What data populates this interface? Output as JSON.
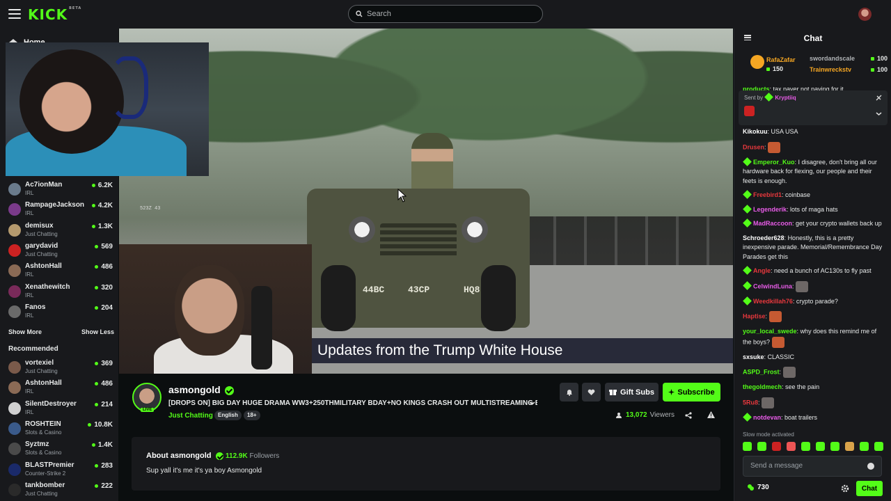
{
  "header": {
    "logo": "KICK",
    "logo_sup": "BETA",
    "search_placeholder": "Search"
  },
  "sidebar": {
    "home_label": "Home",
    "following": [
      {
        "name": "Ac7ionMan",
        "category": "IRL",
        "viewers": "6.2K",
        "color": "#6a7b8c"
      },
      {
        "name": "RampageJackson",
        "category": "IRL",
        "viewers": "4.2K",
        "color": "#7a3a8a"
      },
      {
        "name": "demisux",
        "category": "Just Chatting",
        "viewers": "1.3K",
        "color": "#b59a6e"
      },
      {
        "name": "garydavid",
        "category": "Just Chatting",
        "viewers": "569",
        "color": "#c22"
      },
      {
        "name": "AshtonHall",
        "category": "IRL",
        "viewers": "486",
        "color": "#8a6a55"
      },
      {
        "name": "Xenathewitch",
        "category": "IRL",
        "viewers": "320",
        "color": "#7a2a5a"
      },
      {
        "name": "Fanos",
        "category": "IRL",
        "viewers": "204",
        "color": "#6a6a6a"
      }
    ],
    "show_more": "Show More",
    "show_less": "Show Less",
    "recommended_heading": "Recommended",
    "recommended": [
      {
        "name": "vortexiel",
        "category": "Just Chatting",
        "viewers": "369",
        "color": "#7a5a4a"
      },
      {
        "name": "AshtonHall",
        "category": "IRL",
        "viewers": "486",
        "color": "#8a6a55"
      },
      {
        "name": "SilentDestroyer",
        "category": "IRL",
        "viewers": "214",
        "color": "#d0d0d0"
      },
      {
        "name": "ROSHTEIN",
        "category": "Slots & Casino",
        "viewers": "10.8K",
        "color": "#3a5a8a"
      },
      {
        "name": "Syztmz",
        "category": "Slots & Casino",
        "viewers": "1.4K",
        "color": "#4a4a4a"
      },
      {
        "name": "BLASTPremier",
        "category": "Counter-Strike 2",
        "viewers": "283",
        "color": "#1a2a6a"
      },
      {
        "name": "tankbomber",
        "category": "Just Chatting",
        "viewers": "222",
        "color": "#2a2a2a"
      }
    ]
  },
  "video": {
    "caption": "Updates from the Trump White House",
    "plate_left": "44BC",
    "plate_mid": "43CP",
    "plate_right": "HQ8",
    "truck_plate": "523Z 43"
  },
  "channel": {
    "name": "asmongold",
    "live_badge": "LIVE",
    "title": "[DROPS ON] BIG DAY HUGE DRAMA WW3+250THMILITARY BDAY+NO KINGS CRASH OUT MULTISTREAMING B...",
    "category": "Just Chatting",
    "tags": [
      "English",
      "18+"
    ],
    "gift_label": "Gift Subs",
    "subscribe_label": "Subscribe",
    "viewer_count": "13,072",
    "viewers_label": "Viewers"
  },
  "about": {
    "title": "About asmongold",
    "followers_count": "112.9K",
    "followers_label": "Followers",
    "bio": "Sup yall it's me it's ya boy Asmongold"
  },
  "chat": {
    "title": "Chat",
    "leaders": [
      {
        "name": "RafaZafar",
        "amount": "150",
        "color": "#f5a623"
      },
      {
        "name": "swordandscale",
        "amount": "100",
        "color": "#b0b3b6"
      },
      {
        "name": "Trainwreckstv",
        "amount": "100",
        "color": "#f5a623"
      }
    ],
    "partial_msg_user": "products",
    "partial_msg_text": "tax payer not paying for it",
    "pinned_sent_by": "Sent by",
    "pinned_user": "Kryptiiq",
    "messages": [
      {
        "user": "Kikokuu",
        "text": "USA USA",
        "color": "#ffffff",
        "badge": false,
        "emote": ""
      },
      {
        "user": "Drusen",
        "text": "",
        "color": "#e8383d",
        "badge": false,
        "emote": "red"
      },
      {
        "user": "Emperor_Kuo",
        "text": "I disagree, don't bring all our hardware back for flexing, our people and their feets is enough.",
        "color": "#53fc18",
        "badge": true,
        "emote": ""
      },
      {
        "user": "Freebird1",
        "text": "coinbase",
        "color": "#e8383d",
        "badge": true,
        "emote": ""
      },
      {
        "user": "Legenderik",
        "text": "lots of maga hats",
        "color": "#e85ce8",
        "badge": true,
        "emote": ""
      },
      {
        "user": "MadRaccoon",
        "text": "get your crypto wallets back up",
        "color": "#e85ce8",
        "badge": true,
        "emote": ""
      },
      {
        "user": "Schroeder628",
        "text": "Honestly, this is a pretty inexpensive parade. Memorial/Remembrance Day Parades get this",
        "color": "#ffffff",
        "badge": false,
        "emote": ""
      },
      {
        "user": "Angle",
        "text": "need a bunch of AC130s to fly past",
        "color": "#e8383d",
        "badge": true,
        "emote": ""
      },
      {
        "user": "CelwindLuna",
        "text": "",
        "color": "#e85ce8",
        "badge": true,
        "emote": "grey"
      },
      {
        "user": "Weedkillah76",
        "text": "crypto parade?",
        "color": "#e8383d",
        "badge": true,
        "emote": ""
      },
      {
        "user": "Haptise",
        "text": "",
        "color": "#e8383d",
        "badge": false,
        "emote": "red"
      },
      {
        "user": "your_local_swede",
        "text": "why does this remind me of the boys?",
        "color": "#53fc18",
        "badge": false,
        "emote": "red"
      },
      {
        "user": "sxsuke",
        "text": "CLASSIC",
        "color": "#ffffff",
        "badge": false,
        "emote": ""
      },
      {
        "user": "ASPD_Frost",
        "text": "",
        "color": "#53fc18",
        "badge": false,
        "emote": "grey"
      },
      {
        "user": "thegoldmech",
        "text": "see the pain",
        "color": "#53fc18",
        "badge": false,
        "emote": ""
      },
      {
        "user": "5Ru8",
        "text": "",
        "color": "#e8383d",
        "badge": false,
        "emote": "grey"
      },
      {
        "user": "notdevan",
        "text": "boat trailers",
        "color": "#e85ce8",
        "badge": true,
        "emote": ""
      }
    ],
    "slow_mode": "Slow mode activated",
    "input_placeholder": "Send a message",
    "points": "730",
    "send_label": "Chat"
  }
}
